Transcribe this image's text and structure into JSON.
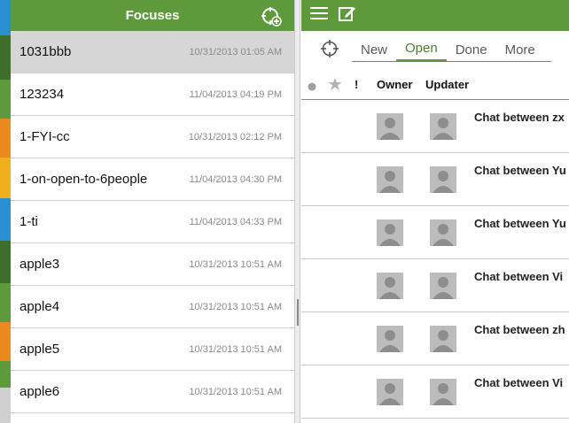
{
  "strip_colors": [
    "#2a8fd0",
    "#3d6e2c",
    "#5e9a3c",
    "#2e6a2a",
    "#e88a1e",
    "#f0b01e",
    "#2a8fd0",
    "#3d6e2c",
    "#5e9a3c",
    "#e88a1e",
    "#cfcfcf",
    "#9a9a9a"
  ],
  "left": {
    "title": "Focuses",
    "items": [
      {
        "name": "1031bbb",
        "date": "10/31/2013 01:05 AM"
      },
      {
        "name": "123234",
        "date": "11/04/2013 04:19 PM"
      },
      {
        "name": "1-FYI-cc",
        "date": "10/31/2013 02:12 PM"
      },
      {
        "name": "1-on-open-to-6people",
        "date": "11/04/2013 04:30 PM"
      },
      {
        "name": "1-ti",
        "date": "11/04/2013 04:33 PM"
      },
      {
        "name": "apple3",
        "date": "10/31/2013 10:51 AM"
      },
      {
        "name": "apple4",
        "date": "10/31/2013 10:51 AM"
      },
      {
        "name": "apple5",
        "date": "10/31/2013 10:51 AM"
      },
      {
        "name": "apple6",
        "date": "10/31/2013 10:51 AM"
      }
    ]
  },
  "right": {
    "tabs": [
      "New",
      "Open",
      "Done",
      "More"
    ],
    "columns": {
      "flag": "!",
      "owner": "Owner",
      "updater": "Updater"
    },
    "chats": [
      {
        "title": "Chat between zx"
      },
      {
        "title": "Chat between Yu"
      },
      {
        "title": "Chat between Yu"
      },
      {
        "title": "Chat between Vi"
      },
      {
        "title": "Chat between zh"
      },
      {
        "title": "Chat between Vi"
      }
    ]
  },
  "colors": {
    "accent": "#5e9a3c",
    "selected": "#d6d6d6"
  }
}
